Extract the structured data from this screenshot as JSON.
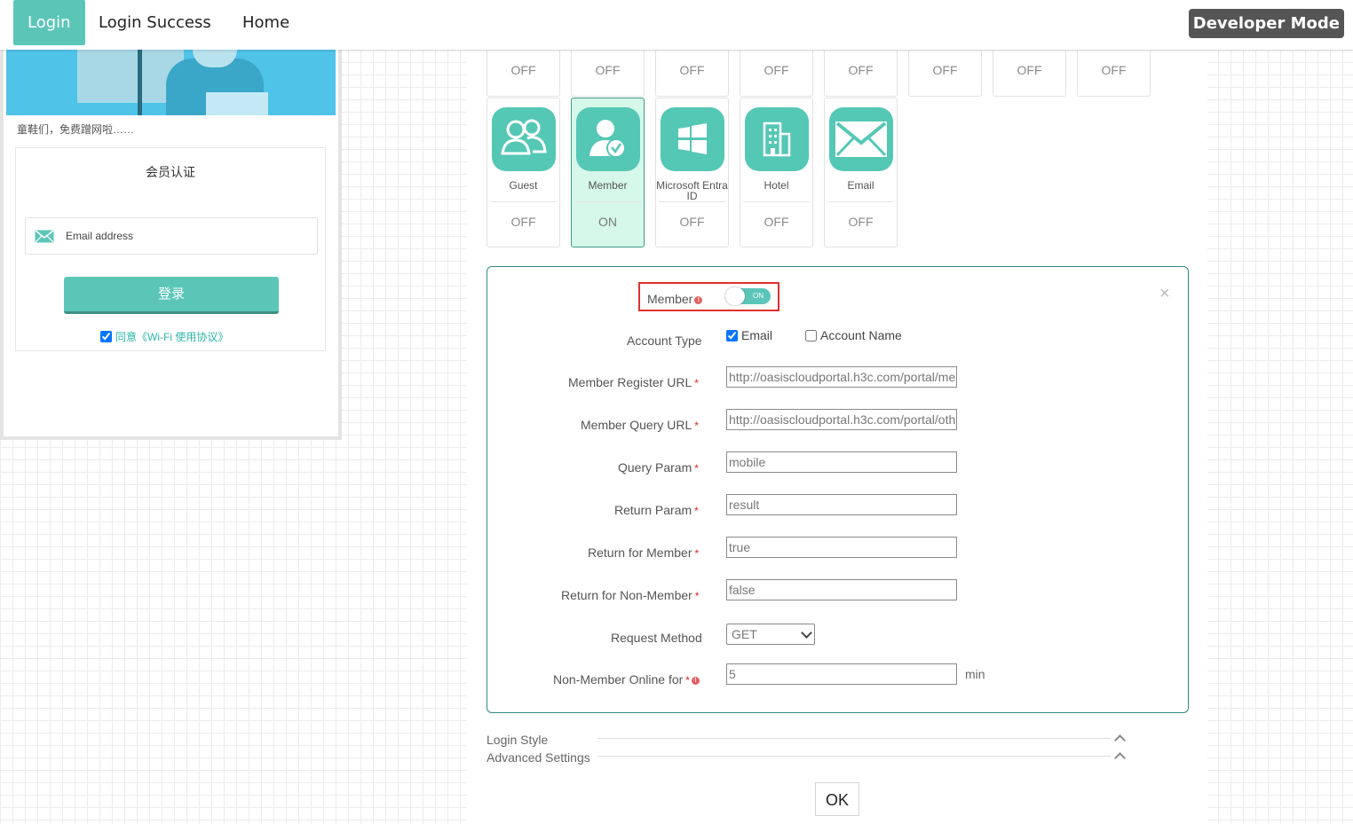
{
  "nav": {
    "tabs": [
      {
        "label": "Login"
      },
      {
        "label": "Login Success"
      },
      {
        "label": "Home"
      }
    ],
    "developer_mode_label": "Developer Mode"
  },
  "preview": {
    "banner_caption": "童鞋们，免费蹭网啦……",
    "auth_title": "会员认证",
    "email_placeholder": "Email address",
    "login_button": "登录",
    "agreement_text": "同意《Wi-Fi 使用协议》",
    "agreement_checked": true
  },
  "auth_methods": {
    "top_row_states": [
      "OFF",
      "OFF",
      "OFF",
      "OFF",
      "OFF",
      "OFF",
      "OFF",
      "OFF"
    ],
    "tiles": [
      {
        "label": "Guest",
        "state": "OFF",
        "icon": "users-icon",
        "active": false
      },
      {
        "label": "Member",
        "state": "ON",
        "icon": "member-check-icon",
        "active": true
      },
      {
        "label": "Microsoft Entra ID",
        "state": "OFF",
        "icon": "windows-icon",
        "active": false
      },
      {
        "label": "Hotel",
        "state": "OFF",
        "icon": "hotel-icon",
        "active": false
      },
      {
        "label": "Email",
        "state": "OFF",
        "icon": "envelope-icon",
        "active": false
      }
    ]
  },
  "member_form": {
    "member_label": "Member",
    "toggle_text": "ON",
    "toggle_on": true,
    "account_type_label": "Account Type",
    "account_type_email": "Email",
    "account_type_email_checked": true,
    "account_type_name": "Account Name",
    "account_type_name_checked": false,
    "register_url_label": "Member Register URL",
    "register_url_value": "http://oasiscloudportal.h3c.com/portal/me",
    "query_url_label": "Member Query URL",
    "query_url_value": "http://oasiscloudportal.h3c.com/portal/oth",
    "query_param_label": "Query Param",
    "query_param_value": "mobile",
    "return_param_label": "Return Param",
    "return_param_value": "result",
    "return_member_label": "Return for Member",
    "return_member_value": "true",
    "return_nonmember_label": "Return for Non-Member",
    "return_nonmember_value": "false",
    "request_method_label": "Request Method",
    "request_method_value": "GET",
    "nonmember_online_label": "Non-Member Online for",
    "nonmember_online_value": "5",
    "nonmember_online_unit": "min",
    "required_mark": "*",
    "info_mark": "!",
    "close_symbol": "×"
  },
  "sections": {
    "login_style": "Login Style",
    "advanced_settings": "Advanced Settings"
  },
  "ok_button": "OK",
  "colors": {
    "accent": "#5bc6b8",
    "active_tile_bg": "#d5f8ea",
    "panel_border": "#2f8c82",
    "highlight": "#e03030"
  }
}
